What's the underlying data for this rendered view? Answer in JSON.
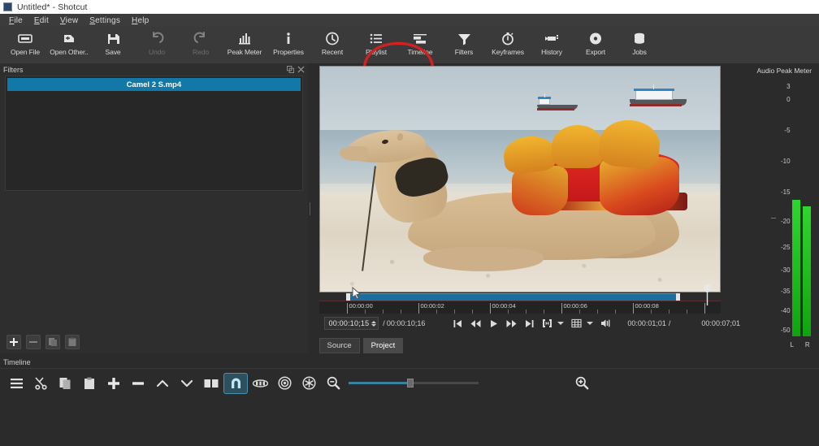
{
  "window": {
    "title": "Untitled* - Shotcut",
    "icon": "app-icon"
  },
  "menubar": {
    "items": [
      {
        "label": "File"
      },
      {
        "label": "Edit"
      },
      {
        "label": "View"
      },
      {
        "label": "Settings"
      },
      {
        "label": "Help"
      }
    ]
  },
  "toolbar": {
    "buttons": [
      {
        "label": "Open File",
        "icon": "open-file-icon",
        "enabled": true
      },
      {
        "label": "Open Other..",
        "icon": "open-other-icon",
        "enabled": true
      },
      {
        "label": "Save",
        "icon": "save-icon",
        "enabled": true
      },
      {
        "label": "Undo",
        "icon": "undo-icon",
        "enabled": false
      },
      {
        "label": "Redo",
        "icon": "redo-icon",
        "enabled": false
      },
      {
        "label": "Peak Meter",
        "icon": "peak-meter-icon",
        "enabled": true
      },
      {
        "label": "Properties",
        "icon": "properties-icon",
        "enabled": true
      },
      {
        "label": "Recent",
        "icon": "recent-icon",
        "enabled": true
      },
      {
        "label": "Playlist",
        "icon": "playlist-icon",
        "enabled": true
      },
      {
        "label": "Timeline",
        "icon": "timeline-icon",
        "enabled": true
      },
      {
        "label": "Filters",
        "icon": "filters-funnel-icon",
        "enabled": true
      },
      {
        "label": "Keyframes",
        "icon": "keyframes-icon",
        "enabled": true
      },
      {
        "label": "History",
        "icon": "history-icon",
        "enabled": true
      },
      {
        "label": "Export",
        "icon": "export-icon",
        "enabled": true
      },
      {
        "label": "Jobs",
        "icon": "jobs-icon",
        "enabled": true
      }
    ],
    "annotation": {
      "shape": "red-ellipse",
      "target": "Filters",
      "color": "#d42020"
    }
  },
  "filters_panel": {
    "title": "Filters",
    "float_icon": "float-panel-icon",
    "close_icon": "close-panel-icon",
    "selected_clip": "Camel 2 S.mp4",
    "selected_color": "#1278a8",
    "actions": [
      {
        "label": "Add filter",
        "icon": "plus-icon",
        "enabled": true
      },
      {
        "label": "Remove filter",
        "icon": "minus-icon",
        "enabled": false
      },
      {
        "label": "Copy checked filters",
        "icon": "copy-icon",
        "enabled": false
      },
      {
        "label": "Paste filters",
        "icon": "paste-icon",
        "enabled": false
      }
    ]
  },
  "player": {
    "preview_alt": "Camel resting on beach with colorful saddle and boats on the sea",
    "ruler_labels": [
      "00:00:00",
      "00:00:02",
      "00:00:04",
      "00:00:06",
      "00:00:08"
    ],
    "position": "00:00:10;15",
    "duration": "00:00:10;16",
    "duration_prefix": "/",
    "in_point": "00:00:01;01",
    "in_point_suffix": "/",
    "selected_duration": "00:00:07;01",
    "transport": [
      {
        "name": "skip-to-start-icon",
        "label": "Skip to start"
      },
      {
        "name": "rewind-icon",
        "label": "Quickly play backwards"
      },
      {
        "name": "play-icon",
        "label": "Play"
      },
      {
        "name": "fast-forward-icon",
        "label": "Quickly play forwards"
      },
      {
        "name": "skip-to-next-icon",
        "label": "Skip to next point"
      },
      {
        "name": "in-out-point-icon",
        "label": "Set in/out point"
      },
      {
        "name": "grid-icon",
        "label": "Toggle grid display"
      },
      {
        "name": "volume-icon",
        "label": "Show volume control"
      }
    ],
    "tabs": [
      {
        "label": "Source",
        "active": false
      },
      {
        "label": "Project",
        "active": true
      }
    ]
  },
  "audio_peak_meter": {
    "title": "Audio Peak Meter",
    "scale": [
      "3",
      "0",
      "-5",
      "-10",
      "-15",
      "-20",
      "-25",
      "-30",
      "-35",
      "-40",
      "-50"
    ],
    "channels": [
      "L",
      "R"
    ],
    "level_color": "#1fc41f",
    "left_level_db": -16,
    "right_level_db": -16.5
  },
  "timeline": {
    "title": "Timeline",
    "buttons": [
      {
        "name": "timeline-menu-icon",
        "label": "Timeline menu",
        "active": false
      },
      {
        "name": "cut-icon",
        "label": "Cut",
        "active": false
      },
      {
        "name": "copy-icon",
        "label": "Copy",
        "active": false
      },
      {
        "name": "paste-icon",
        "label": "Paste",
        "active": false
      },
      {
        "name": "append-icon",
        "label": "Append",
        "active": false
      },
      {
        "name": "ripple-delete-icon",
        "label": "Ripple Delete",
        "active": false
      },
      {
        "name": "lift-icon",
        "label": "Lift",
        "active": false
      },
      {
        "name": "overwrite-icon",
        "label": "Overwrite",
        "active": false
      },
      {
        "name": "split-icon",
        "label": "Split At Playhead",
        "active": false
      },
      {
        "name": "snap-magnet-icon",
        "label": "Toggle snapping",
        "active": true
      },
      {
        "name": "scrub-while-dragging-icon",
        "label": "Scrub while dragging",
        "active": false
      },
      {
        "name": "ripple-icon",
        "label": "Ripple",
        "active": false
      },
      {
        "name": "ripple-all-tracks-icon",
        "label": "Ripple all tracks",
        "active": false
      },
      {
        "name": "zoom-out-icon",
        "label": "Zoom timeline out",
        "active": false
      }
    ],
    "zoom_value_percent": 45,
    "zoom_in_icon": "zoom-in-icon"
  }
}
